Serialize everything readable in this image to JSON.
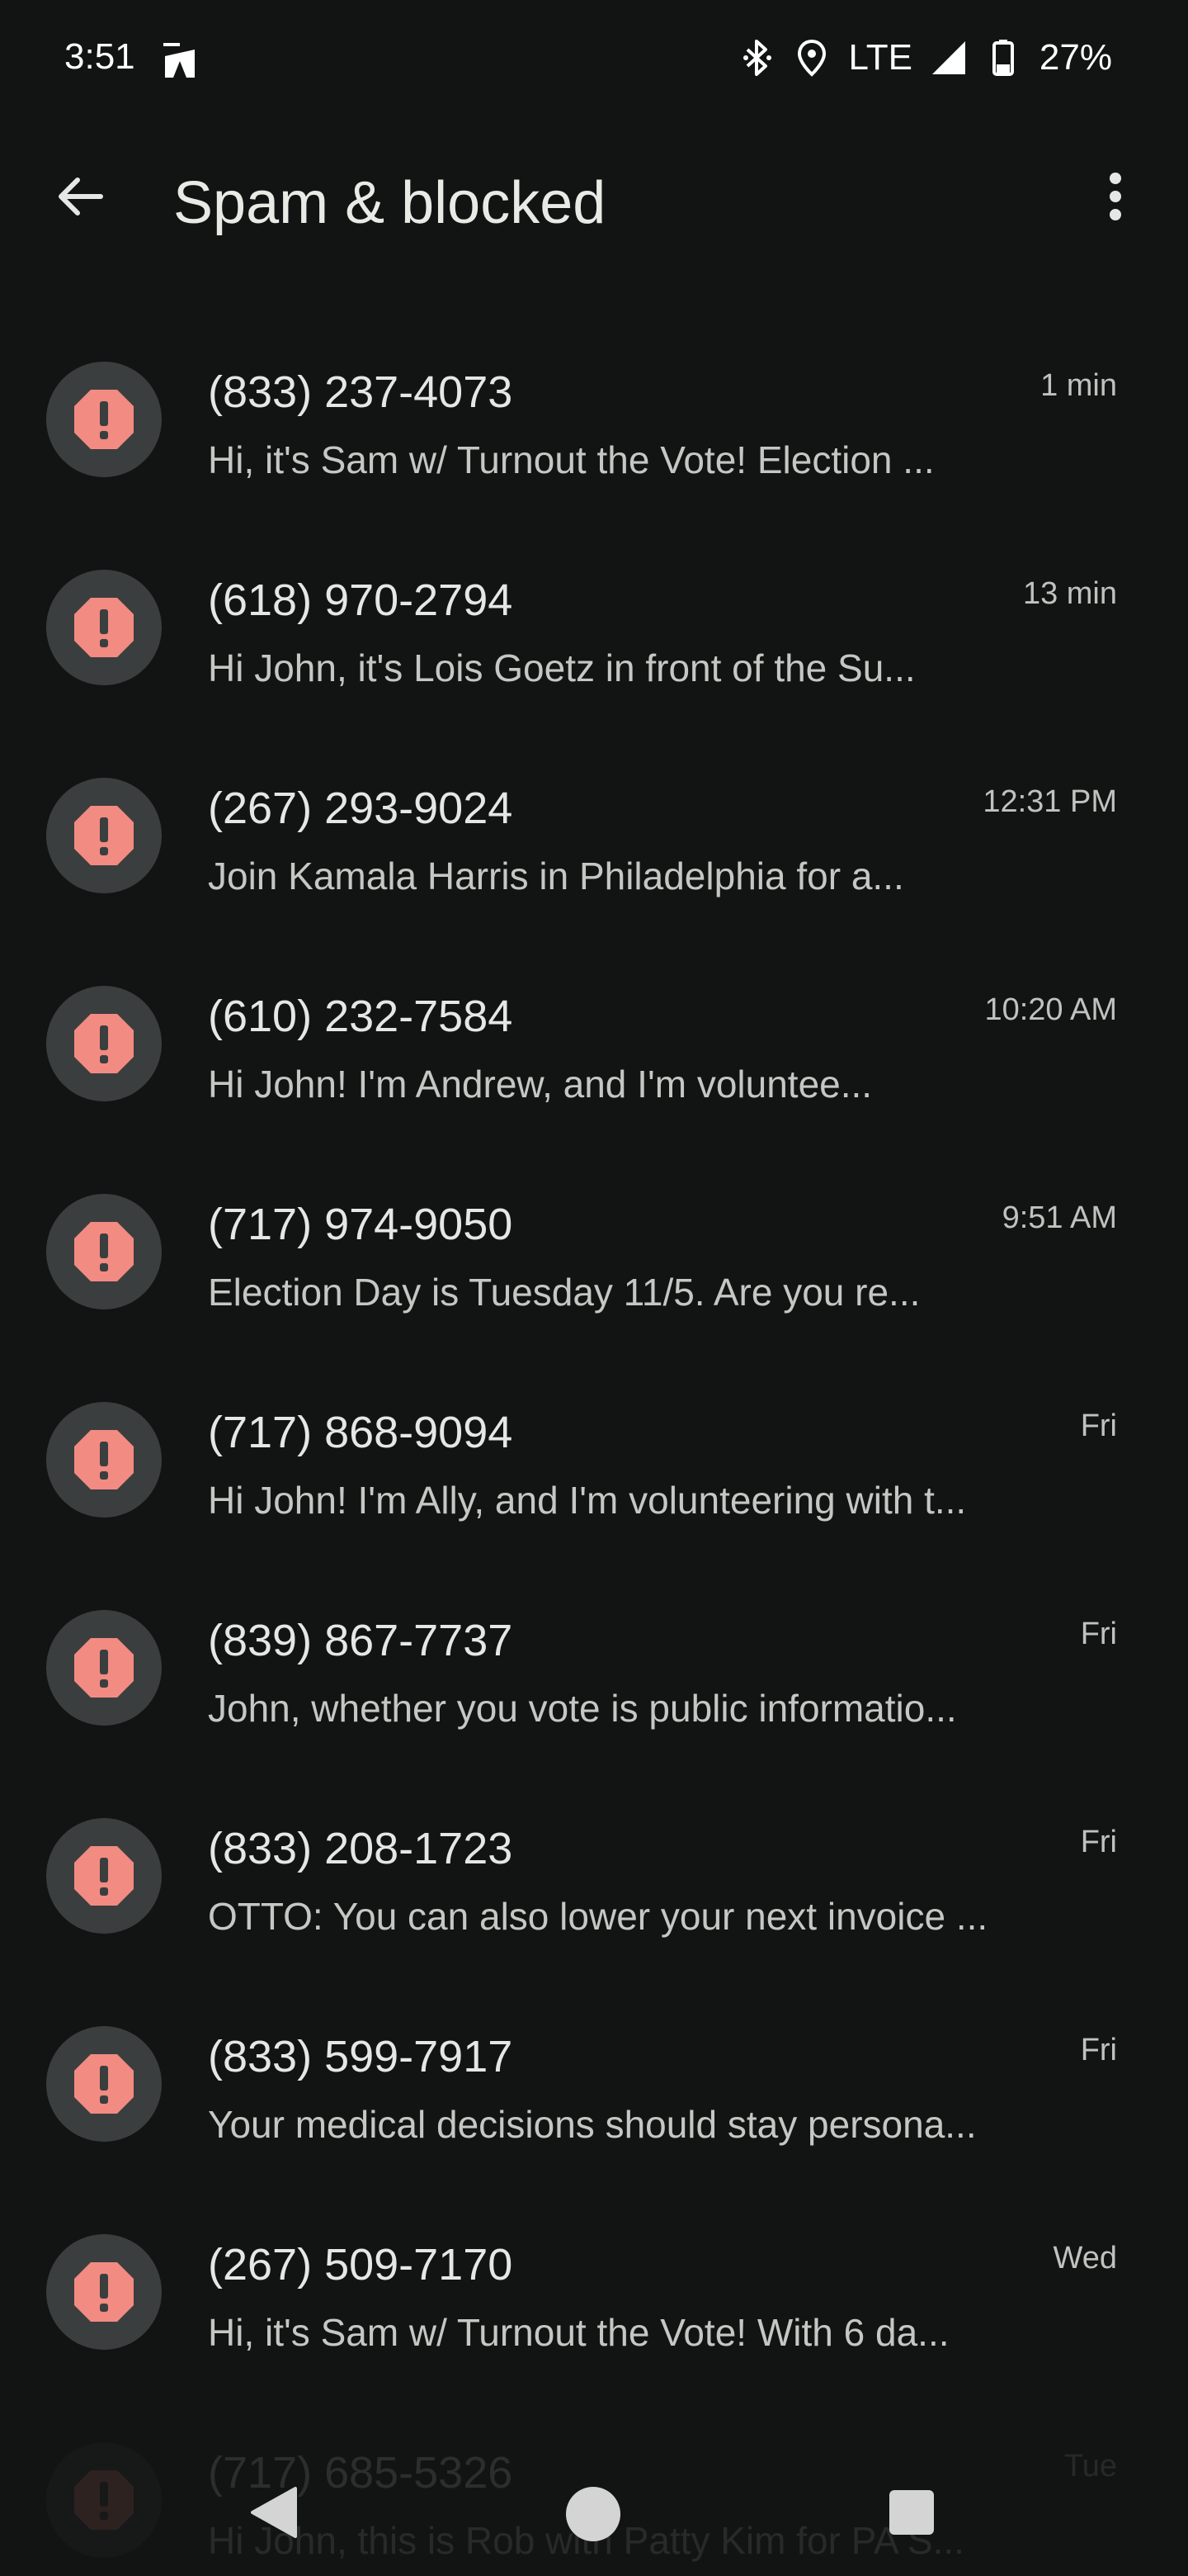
{
  "status_bar": {
    "time": "3:51",
    "network": "LTE",
    "battery": "27%",
    "icons": [
      "app-notification-icon",
      "bluetooth-icon",
      "location-icon",
      "signal-icon",
      "battery-icon"
    ]
  },
  "app_bar": {
    "title": "Spam & blocked",
    "back_icon": "arrow-back-icon",
    "more_icon": "more-vert-icon"
  },
  "colors": {
    "background": "#111412",
    "avatar_bg": "#3b3e3f",
    "alert_icon": "#f28b82"
  },
  "conversations": [
    {
      "number": "(833) 237-4073",
      "preview": "Hi, it's Sam w/ Turnout the Vote! Election ...",
      "time": "1 min"
    },
    {
      "number": "(618) 970-2794",
      "preview": "Hi John, it's Lois Goetz in front of the Su...",
      "time": "13 min"
    },
    {
      "number": "(267) 293-9024",
      "preview": "Join Kamala Harris in Philadelphia for a...",
      "time": "12:31 PM"
    },
    {
      "number": "(610) 232-7584",
      "preview": "Hi John! I'm Andrew, and I'm voluntee...",
      "time": "10:20 AM"
    },
    {
      "number": "(717) 974-9050",
      "preview": "Election Day is Tuesday 11/5. Are you re...",
      "time": "9:51 AM"
    },
    {
      "number": "(717) 868-9094",
      "preview": "Hi John! I'm Ally, and I'm volunteering with t...",
      "time": "Fri"
    },
    {
      "number": "(839) 867-7737",
      "preview": "John, whether you vote is public informatio...",
      "time": "Fri"
    },
    {
      "number": "(833) 208-1723",
      "preview": "OTTO: You can also lower your next invoice ...",
      "time": "Fri"
    },
    {
      "number": "(833) 599-7917",
      "preview": "Your medical decisions should stay persona...",
      "time": "Fri"
    },
    {
      "number": "(267) 509-7170",
      "preview": "Hi, it's Sam w/ Turnout the Vote! With 6 da...",
      "time": "Wed"
    },
    {
      "number": "(717) 685-5326",
      "preview": "Hi John, this is Rob with Patty Kim for PA S...",
      "time": "Tue"
    }
  ],
  "nav_bar": {
    "icons": [
      "nav-back-icon",
      "nav-home-icon",
      "nav-recents-icon"
    ]
  }
}
